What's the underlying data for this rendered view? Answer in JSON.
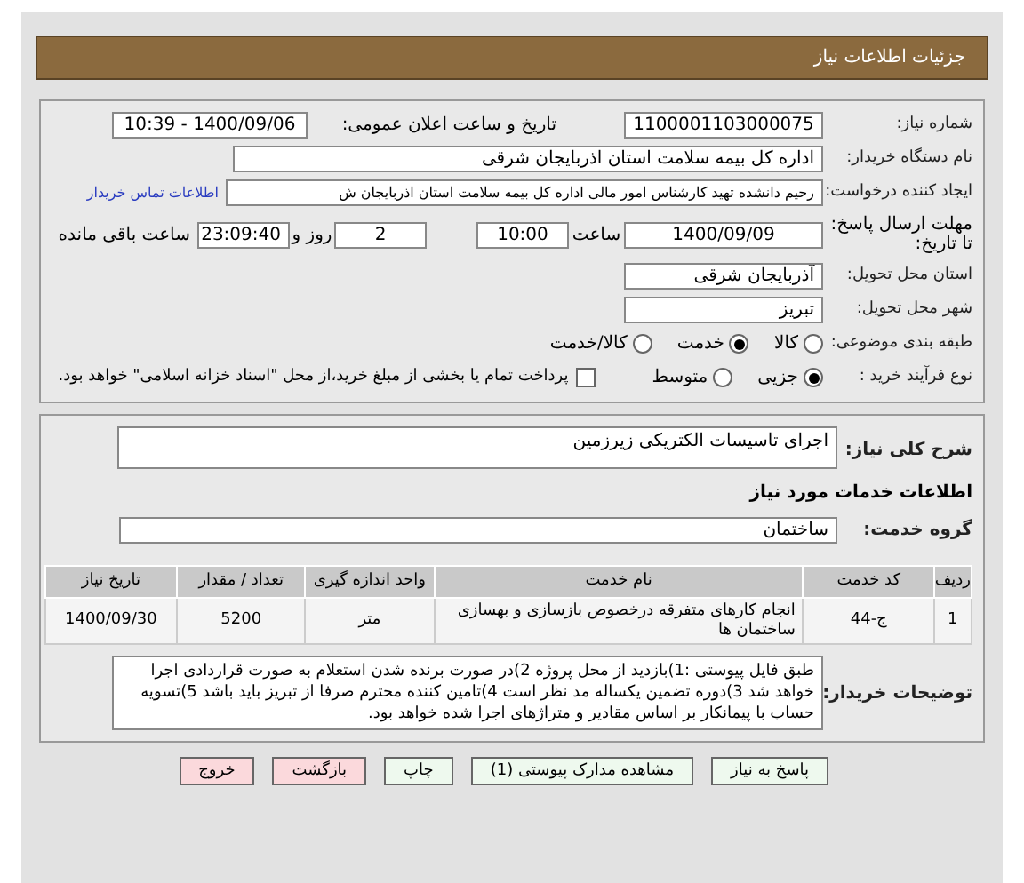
{
  "header": {
    "title": "جزئیات اطلاعات نیاز"
  },
  "need_number": {
    "label": "شماره نیاز:",
    "value": "1100001103000075"
  },
  "announce": {
    "label": "تاریخ و ساعت اعلان عمومی:",
    "value": "1400/09/06 - 10:39"
  },
  "buyer_org": {
    "label": "نام دستگاه خریدار:",
    "value": "اداره کل بیمه سلامت استان اذربایجان شرقی"
  },
  "requester": {
    "label": "ایجاد کننده درخواست:",
    "value": "رحیم  دانشده تهید کارشناس امور مالی اداره کل بیمه سلامت استان اذربایجان ش",
    "link": "اطلاعات تماس خریدار"
  },
  "deadline": {
    "label": "مهلت ارسال پاسخ: تا تاریخ:",
    "date": "1400/09/09",
    "time_label": "ساعت",
    "time": "10:00",
    "days": "2",
    "days_label": "روز و",
    "remaining": "23:09:40",
    "remaining_label": "ساعت باقی مانده"
  },
  "province": {
    "label": "استان محل تحویل:",
    "value": "آذربایجان شرقی"
  },
  "city": {
    "label": "شهر محل تحویل:",
    "value": "تبریز"
  },
  "category": {
    "label": "طبقه بندی موضوعی:",
    "options": [
      {
        "label": "کالا",
        "selected": false
      },
      {
        "label": "خدمت",
        "selected": true
      },
      {
        "label": "کالا/خدمت",
        "selected": false
      }
    ]
  },
  "process": {
    "label": "نوع فرآیند خرید :",
    "options": [
      {
        "label": "جزیی",
        "selected": true
      },
      {
        "label": "متوسط",
        "selected": false
      }
    ],
    "checkbox": {
      "label": "پرداخت تمام یا بخشی از مبلغ خرید،از محل \"اسناد خزانه اسلامی\" خواهد بود.",
      "checked": false
    }
  },
  "description": {
    "label": "شرح کلی نیاز:",
    "value": "اجرای تاسیسات الکتریکی زیرزمین"
  },
  "services_title": "اطلاعات خدمات مورد نیاز",
  "service_group": {
    "label": "گروه خدمت:",
    "value": "ساختمان"
  },
  "table": {
    "columns": [
      "ردیف",
      "کد خدمت",
      "نام خدمت",
      "واحد اندازه گیری",
      "تعداد / مقدار",
      "تاریخ نیاز"
    ],
    "rows": [
      [
        "1",
        "ج-44",
        "انجام کارهای متفرقه درخصوص بازسازی و بهسازی ساختمان ها",
        "متر",
        "5200",
        "1400/09/30"
      ]
    ]
  },
  "buyer_notes": {
    "label": "توضیحات خریدار:",
    "value": "طبق فایل پیوستی :1)بازدید از محل پروژه 2)در صورت برنده شدن استعلام به صورت قراردادی اجرا خواهد شد 3)دوره تضمین یکساله مد نظر است 4)تامین کننده محترم صرفا از تبریز باید باشد 5)تسویه حساب با پیمانکار بر اساس مقادیر و متراژهای اجرا شده خواهد بود."
  },
  "buttons": [
    {
      "label": "پاسخ به نیاز",
      "kind": "primary"
    },
    {
      "label": "مشاهده مدارک پیوستی (1)",
      "kind": "primary"
    },
    {
      "label": "چاپ",
      "kind": "primary"
    },
    {
      "label": "بازگشت",
      "kind": "danger"
    },
    {
      "label": "خروج",
      "kind": "danger"
    }
  ]
}
